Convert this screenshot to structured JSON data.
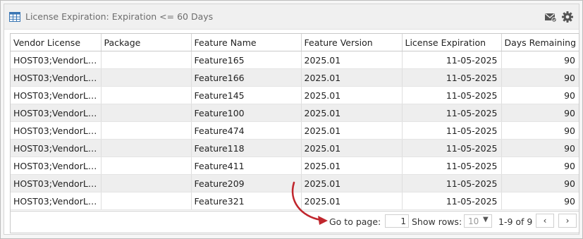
{
  "header": {
    "title": "License Expiration: Expiration <= 60 Days",
    "icons": [
      "table-icon",
      "email-icon",
      "gear-icon"
    ]
  },
  "table": {
    "columns": [
      "Vendor License",
      "Package",
      "Feature Name",
      "Feature Version",
      "License Expiration",
      "Days Remaining"
    ],
    "rows": [
      [
        "HOST03;VendorLi...",
        "",
        "Feature165",
        "2025.01",
        "11-05-2025",
        "90"
      ],
      [
        "HOST03;VendorLi...",
        "",
        "Feature166",
        "2025.01",
        "11-05-2025",
        "90"
      ],
      [
        "HOST03;VendorLi...",
        "",
        "Feature145",
        "2025.01",
        "11-05-2025",
        "90"
      ],
      [
        "HOST03;VendorLi...",
        "",
        "Feature100",
        "2025.01",
        "11-05-2025",
        "90"
      ],
      [
        "HOST03;VendorLi...",
        "",
        "Feature474",
        "2025.01",
        "11-05-2025",
        "90"
      ],
      [
        "HOST03;VendorLi...",
        "",
        "Feature118",
        "2025.01",
        "11-05-2025",
        "90"
      ],
      [
        "HOST03;VendorLi...",
        "",
        "Feature411",
        "2025.01",
        "11-05-2025",
        "90"
      ],
      [
        "HOST03;VendorLi...",
        "",
        "Feature209",
        "2025.01",
        "11-05-2025",
        "90"
      ],
      [
        "HOST03;VendorLi...",
        "",
        "Feature321",
        "2025.01",
        "11-05-2025",
        "90"
      ]
    ]
  },
  "footer": {
    "go_to_page_label": "Go to page:",
    "page_value": "1",
    "show_rows_label": "Show rows:",
    "rows_value": "10",
    "range_text": "1-9 of 9",
    "prev_symbol": "‹",
    "next_symbol": "›"
  },
  "colors": {
    "accent_annotation": "#c0262d",
    "alt_row": "#eeeeee",
    "header_bar": "#f0f0f0"
  }
}
